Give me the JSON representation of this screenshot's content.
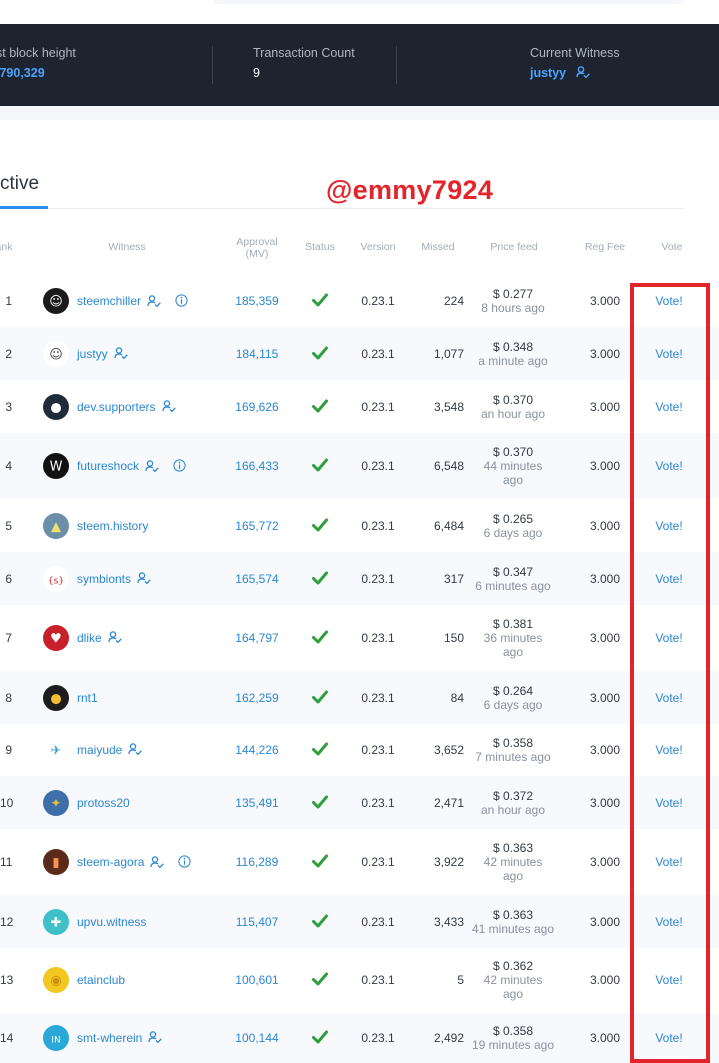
{
  "stats": {
    "block_height_label": "st block height",
    "block_height_value": ",790,329",
    "tx_count_label": "Transaction Count",
    "tx_count_value": "9",
    "witness_label": "Current Witness",
    "witness_value": "justyy"
  },
  "tab": {
    "label": "ctive"
  },
  "watermark": "@emmy7924",
  "headers": {
    "rank": "ank",
    "witness": "Witness",
    "approval_line1": "Approval",
    "approval_line2": "(MV)",
    "status": "Status",
    "version": "Version",
    "missed": "Missed",
    "price_feed": "Price feed",
    "reg_fee": "Reg Fee",
    "vote": "Vote"
  },
  "rows": [
    {
      "rank": "1",
      "name": "steemchiller",
      "approval": "185,359",
      "version": "0.23.1",
      "missed": "224",
      "price": "$ 0.277",
      "p1": "8 hours ago",
      "p2": "",
      "fee": "3.000",
      "vote": "Vote!"
    },
    {
      "rank": "2",
      "name": "justyy",
      "approval": "184,115",
      "version": "0.23.1",
      "missed": "1,077",
      "price": "$ 0.348",
      "p1": "a minute ago",
      "p2": "",
      "fee": "3.000",
      "vote": "Vote!"
    },
    {
      "rank": "3",
      "name": "dev.supporters",
      "approval": "169,626",
      "version": "0.23.1",
      "missed": "3,548",
      "price": "$ 0.370",
      "p1": "an hour ago",
      "p2": "",
      "fee": "3.000",
      "vote": "Vote!"
    },
    {
      "rank": "4",
      "name": "futureshock",
      "approval": "166,433",
      "version": "0.23.1",
      "missed": "6,548",
      "price": "$ 0.370",
      "p1": "44 minutes",
      "p2": "ago",
      "fee": "3.000",
      "vote": "Vote!"
    },
    {
      "rank": "5",
      "name": "steem.history",
      "approval": "165,772",
      "version": "0.23.1",
      "missed": "6,484",
      "price": "$ 0.265",
      "p1": "6 days ago",
      "p2": "",
      "fee": "3.000",
      "vote": "Vote!"
    },
    {
      "rank": "6",
      "name": "symbionts",
      "approval": "165,574",
      "version": "0.23.1",
      "missed": "317",
      "price": "$ 0.347",
      "p1": "6 minutes ago",
      "p2": "",
      "fee": "3.000",
      "vote": "Vote!"
    },
    {
      "rank": "7",
      "name": "dlike",
      "approval": "164,797",
      "version": "0.23.1",
      "missed": "150",
      "price": "$ 0.381",
      "p1": "36 minutes",
      "p2": "ago",
      "fee": "3.000",
      "vote": "Vote!"
    },
    {
      "rank": "8",
      "name": "rnt1",
      "approval": "162,259",
      "version": "0.23.1",
      "missed": "84",
      "price": "$ 0.264",
      "p1": "6 days ago",
      "p2": "",
      "fee": "3.000",
      "vote": "Vote!"
    },
    {
      "rank": "9",
      "name": "maiyude",
      "approval": "144,226",
      "version": "0.23.1",
      "missed": "3,652",
      "price": "$ 0.358",
      "p1": "7 minutes ago",
      "p2": "",
      "fee": "3.000",
      "vote": "Vote!"
    },
    {
      "rank": "10",
      "name": "protoss20",
      "approval": "135,491",
      "version": "0.23.1",
      "missed": "2,471",
      "price": "$ 0.372",
      "p1": "an hour ago",
      "p2": "",
      "fee": "3.000",
      "vote": "Vote!"
    },
    {
      "rank": "11",
      "name": "steem-agora",
      "approval": "116,289",
      "version": "0.23.1",
      "missed": "3,922",
      "price": "$ 0.363",
      "p1": "42 minutes",
      "p2": "ago",
      "fee": "3.000",
      "vote": "Vote!"
    },
    {
      "rank": "12",
      "name": "upvu.witness",
      "approval": "115,407",
      "version": "0.23.1",
      "missed": "3,433",
      "price": "$ 0.363",
      "p1": "41 minutes ago",
      "p2": "",
      "fee": "3.000",
      "vote": "Vote!"
    },
    {
      "rank": "13",
      "name": "etainclub",
      "approval": "100,601",
      "version": "0.23.1",
      "missed": "5",
      "price": "$ 0.362",
      "p1": "42 minutes",
      "p2": "ago",
      "fee": "3.000",
      "vote": "Vote!"
    },
    {
      "rank": "14",
      "name": "smt-wherein",
      "approval": "100,144",
      "version": "0.23.1",
      "missed": "2,492",
      "price": "$ 0.358",
      "p1": "19 minutes ago",
      "p2": "",
      "fee": "3.000",
      "vote": "Vote!"
    }
  ]
}
